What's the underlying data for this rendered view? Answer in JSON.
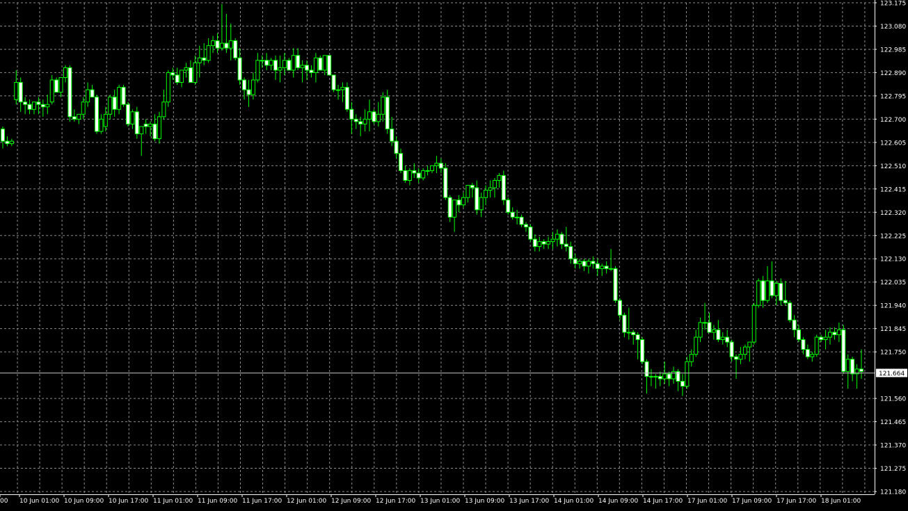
{
  "chart_data": {
    "type": "candlestick",
    "timeframe": "H1",
    "ylim": [
      121.18,
      123.175
    ],
    "y_ticks": [
      "123.175",
      "123.080",
      "122.985",
      "122.890",
      "122.795",
      "122.700",
      "122.605",
      "122.510",
      "122.415",
      "122.320",
      "122.225",
      "122.130",
      "122.035",
      "121.940",
      "121.845",
      "121.750",
      "121.664",
      "121.560",
      "121.465",
      "121.370",
      "121.275",
      "121.180"
    ],
    "x_ticks": [
      "00",
      "10 Jun 01:00",
      "10 Jun 09:00",
      "10 Jun 17:00",
      "11 Jun 01:00",
      "11 Jun 09:00",
      "11 Jun 17:00",
      "12 Jun 01:00",
      "12 Jun 09:00",
      "12 Jun 17:00",
      "13 Jun 01:00",
      "13 Jun 09:00",
      "13 Jun 17:00",
      "14 Jun 01:00",
      "14 Jun 09:00",
      "14 Jun 17:00",
      "17 Jun 01:00",
      "17 Jun 09:00",
      "17 Jun 17:00",
      "18 Jun 01:00"
    ],
    "current_price": "121.664",
    "grid": true,
    "colors": {
      "background": "#000000",
      "grid": "#8c8c8c",
      "axis_text": "#ffffff",
      "bull_body": "#000000",
      "bear_body": "#ffffff",
      "wick": "#00ff00",
      "price_line": "#c0c0c0"
    },
    "candles": [
      [
        122.66,
        122.67,
        122.58,
        122.61
      ],
      [
        122.61,
        122.63,
        122.59,
        122.6
      ],
      [
        122.6,
        122.62,
        122.59,
        122.61
      ],
      [
        122.78,
        122.9,
        122.76,
        122.85
      ],
      [
        122.85,
        122.87,
        122.73,
        122.77
      ],
      [
        122.77,
        122.79,
        122.72,
        122.76
      ],
      [
        122.76,
        122.78,
        122.72,
        122.74
      ],
      [
        122.74,
        122.77,
        122.72,
        122.77
      ],
      [
        122.77,
        122.79,
        122.72,
        122.76
      ],
      [
        122.76,
        122.78,
        122.71,
        122.75
      ],
      [
        122.75,
        122.8,
        122.72,
        122.76
      ],
      [
        122.77,
        122.88,
        122.76,
        122.86
      ],
      [
        122.86,
        122.87,
        122.81,
        122.81
      ],
      [
        122.81,
        122.87,
        122.79,
        122.87
      ],
      [
        122.87,
        122.92,
        122.85,
        122.91
      ],
      [
        122.91,
        122.92,
        122.69,
        122.71
      ],
      [
        122.71,
        122.74,
        122.69,
        122.7
      ],
      [
        122.7,
        122.72,
        122.68,
        122.72
      ],
      [
        122.72,
        122.79,
        122.7,
        122.77
      ],
      [
        122.77,
        122.85,
        122.75,
        122.82
      ],
      [
        122.82,
        122.84,
        122.79,
        122.79
      ],
      [
        122.79,
        122.8,
        122.64,
        122.65
      ],
      [
        122.65,
        122.72,
        122.64,
        122.7
      ],
      [
        122.67,
        122.75,
        122.65,
        122.72
      ],
      [
        122.72,
        122.8,
        122.7,
        122.79
      ],
      [
        122.79,
        122.82,
        122.71,
        122.74
      ],
      [
        122.74,
        122.84,
        122.72,
        122.83
      ],
      [
        122.83,
        122.84,
        122.75,
        122.76
      ],
      [
        122.76,
        122.77,
        122.67,
        122.68
      ],
      [
        122.68,
        122.74,
        122.66,
        122.73
      ],
      [
        122.73,
        122.75,
        122.62,
        122.64
      ],
      [
        122.64,
        122.65,
        122.55,
        122.67
      ],
      [
        122.68,
        122.7,
        122.64,
        122.67
      ],
      [
        122.67,
        122.69,
        122.63,
        122.68
      ],
      [
        122.68,
        122.72,
        122.61,
        122.62
      ],
      [
        122.62,
        122.73,
        122.6,
        122.71
      ],
      [
        122.71,
        122.82,
        122.7,
        122.77
      ],
      [
        122.77,
        122.9,
        122.75,
        122.89
      ],
      [
        122.89,
        122.91,
        122.86,
        122.88
      ],
      [
        122.88,
        122.91,
        122.84,
        122.85
      ],
      [
        122.85,
        122.9,
        122.83,
        122.9
      ],
      [
        122.9,
        122.93,
        122.87,
        122.91
      ],
      [
        122.91,
        122.94,
        122.86,
        122.85
      ],
      [
        122.85,
        122.96,
        122.84,
        122.93
      ],
      [
        122.93,
        123.0,
        122.87,
        122.95
      ],
      [
        122.95,
        123.01,
        122.92,
        122.94
      ],
      [
        122.94,
        123.03,
        122.93,
        123.0
      ],
      [
        123.0,
        123.04,
        122.97,
        123.02
      ],
      [
        123.02,
        123.05,
        122.97,
        122.99
      ],
      [
        122.99,
        123.17,
        122.98,
        123.01
      ],
      [
        123.01,
        123.13,
        122.97,
        122.99
      ],
      [
        122.99,
        123.09,
        122.94,
        123.02
      ],
      [
        123.02,
        123.03,
        122.94,
        122.95
      ],
      [
        122.95,
        122.99,
        122.84,
        122.86
      ],
      [
        122.86,
        122.87,
        122.78,
        122.82
      ],
      [
        122.82,
        122.86,
        122.75,
        122.8
      ],
      [
        122.8,
        122.89,
        122.78,
        122.86
      ],
      [
        122.86,
        122.97,
        122.85,
        122.94
      ],
      [
        122.94,
        122.96,
        122.91,
        122.94
      ],
      [
        122.94,
        122.97,
        122.9,
        122.92
      ],
      [
        122.92,
        122.95,
        122.9,
        122.94
      ],
      [
        122.94,
        122.96,
        122.86,
        122.9
      ],
      [
        122.9,
        122.96,
        122.85,
        122.91
      ],
      [
        122.91,
        122.97,
        122.88,
        122.94
      ],
      [
        122.94,
        122.95,
        122.9,
        122.9
      ],
      [
        122.9,
        122.99,
        122.87,
        122.96
      ],
      [
        122.96,
        122.99,
        122.9,
        122.91
      ],
      [
        122.91,
        122.94,
        122.85,
        122.92
      ],
      [
        122.92,
        122.94,
        122.86,
        122.9
      ],
      [
        122.9,
        122.92,
        122.87,
        122.89
      ],
      [
        122.89,
        122.97,
        122.85,
        122.95
      ],
      [
        122.95,
        122.96,
        122.9,
        122.9
      ],
      [
        122.9,
        122.96,
        122.88,
        122.96
      ],
      [
        122.96,
        122.96,
        122.88,
        122.88
      ],
      [
        122.88,
        122.88,
        122.81,
        122.82
      ],
      [
        122.82,
        122.84,
        122.78,
        122.82
      ],
      [
        122.82,
        122.85,
        122.77,
        122.83
      ],
      [
        122.83,
        122.85,
        122.73,
        122.74
      ],
      [
        122.74,
        122.77,
        122.64,
        122.7
      ],
      [
        122.7,
        122.72,
        122.66,
        122.69
      ],
      [
        122.69,
        122.71,
        122.63,
        122.68
      ],
      [
        122.68,
        122.74,
        122.65,
        122.7
      ],
      [
        122.7,
        122.78,
        122.65,
        122.73
      ],
      [
        122.73,
        122.74,
        122.68,
        122.69
      ],
      [
        122.69,
        122.77,
        122.67,
        122.72
      ],
      [
        122.72,
        122.81,
        122.69,
        122.79
      ],
      [
        122.79,
        122.82,
        122.64,
        122.66
      ],
      [
        122.66,
        122.71,
        122.59,
        122.61
      ],
      [
        122.61,
        122.63,
        122.54,
        122.56
      ],
      [
        122.56,
        122.58,
        122.48,
        122.49
      ],
      [
        122.49,
        122.51,
        122.44,
        122.45
      ],
      [
        122.45,
        122.5,
        122.43,
        122.49
      ],
      [
        122.49,
        122.52,
        122.46,
        122.48
      ],
      [
        122.48,
        122.5,
        122.44,
        122.46
      ],
      [
        122.46,
        122.5,
        122.45,
        122.49
      ],
      [
        122.49,
        122.51,
        122.47,
        122.49
      ],
      [
        122.49,
        122.51,
        122.48,
        122.51
      ],
      [
        122.51,
        122.55,
        122.48,
        122.52
      ],
      [
        122.52,
        122.54,
        122.48,
        122.5
      ],
      [
        122.5,
        122.52,
        122.37,
        122.38
      ],
      [
        122.38,
        122.39,
        122.28,
        122.3
      ],
      [
        122.3,
        122.37,
        122.24,
        122.37
      ],
      [
        122.37,
        122.39,
        122.32,
        122.35
      ],
      [
        122.35,
        122.4,
        122.34,
        122.38
      ],
      [
        122.38,
        122.43,
        122.36,
        122.43
      ],
      [
        122.43,
        122.44,
        122.38,
        122.42
      ],
      [
        122.42,
        122.45,
        122.31,
        122.33
      ],
      [
        122.33,
        122.4,
        122.3,
        122.38
      ],
      [
        122.38,
        122.43,
        122.35,
        122.41
      ],
      [
        122.41,
        122.45,
        122.38,
        122.42
      ],
      [
        122.42,
        122.46,
        122.38,
        122.45
      ],
      [
        122.45,
        122.48,
        122.42,
        122.47
      ],
      [
        122.47,
        122.49,
        122.35,
        122.37
      ],
      [
        122.37,
        122.38,
        122.31,
        122.32
      ],
      [
        122.32,
        122.34,
        122.29,
        122.3
      ],
      [
        122.3,
        122.33,
        122.27,
        122.3
      ],
      [
        122.3,
        122.31,
        122.26,
        122.27
      ],
      [
        122.27,
        122.28,
        122.24,
        122.26
      ],
      [
        122.26,
        122.27,
        122.2,
        122.21
      ],
      [
        122.21,
        122.23,
        122.16,
        122.18
      ],
      [
        122.18,
        122.22,
        122.16,
        122.2
      ],
      [
        122.2,
        122.21,
        122.17,
        122.19
      ],
      [
        122.19,
        122.22,
        122.17,
        122.2
      ],
      [
        122.2,
        122.24,
        122.17,
        122.21
      ],
      [
        122.21,
        122.25,
        122.18,
        122.23
      ],
      [
        122.23,
        122.24,
        122.17,
        122.19
      ],
      [
        122.19,
        122.26,
        122.16,
        122.18
      ],
      [
        122.18,
        122.2,
        122.11,
        122.13
      ],
      [
        122.13,
        122.15,
        122.09,
        122.11
      ],
      [
        122.11,
        122.13,
        122.09,
        122.12
      ],
      [
        122.12,
        122.13,
        122.08,
        122.1
      ],
      [
        122.1,
        122.13,
        122.07,
        122.12
      ],
      [
        122.12,
        122.14,
        122.09,
        122.11
      ],
      [
        122.11,
        122.13,
        122.06,
        122.09
      ],
      [
        122.09,
        122.11,
        122.06,
        122.1
      ],
      [
        122.1,
        122.12,
        122.07,
        122.09
      ],
      [
        122.09,
        122.17,
        122.08,
        122.09
      ],
      [
        122.09,
        122.1,
        121.95,
        121.96
      ],
      [
        121.96,
        121.97,
        121.88,
        121.9
      ],
      [
        121.9,
        121.91,
        121.81,
        121.83
      ],
      [
        121.83,
        121.93,
        121.8,
        121.83
      ],
      [
        121.83,
        121.84,
        121.78,
        121.82
      ],
      [
        121.82,
        121.83,
        121.72,
        121.8
      ],
      [
        121.8,
        121.81,
        121.7,
        121.71
      ],
      [
        121.71,
        121.72,
        121.58,
        121.65
      ],
      [
        121.65,
        121.68,
        121.61,
        121.65
      ],
      [
        121.65,
        121.66,
        121.6,
        121.65
      ],
      [
        121.65,
        121.67,
        121.61,
        121.64
      ],
      [
        121.64,
        121.71,
        121.62,
        121.66
      ],
      [
        121.66,
        121.67,
        121.61,
        121.64
      ],
      [
        121.64,
        121.69,
        121.62,
        121.67
      ],
      [
        121.67,
        121.68,
        121.59,
        121.63
      ],
      [
        121.63,
        121.66,
        121.57,
        121.61
      ],
      [
        121.61,
        121.73,
        121.6,
        121.71
      ],
      [
        121.71,
        121.76,
        121.69,
        121.74
      ],
      [
        121.74,
        121.84,
        121.73,
        121.81
      ],
      [
        121.81,
        121.89,
        121.79,
        121.87
      ],
      [
        121.87,
        121.95,
        121.84,
        121.87
      ],
      [
        121.87,
        121.91,
        121.83,
        121.83
      ],
      [
        121.83,
        121.86,
        121.8,
        121.84
      ],
      [
        121.84,
        121.88,
        121.79,
        121.8
      ],
      [
        121.8,
        121.83,
        121.78,
        121.81
      ],
      [
        121.81,
        121.84,
        121.77,
        121.79
      ],
      [
        121.79,
        121.8,
        121.71,
        121.73
      ],
      [
        121.73,
        121.74,
        121.64,
        121.72
      ],
      [
        121.72,
        121.77,
        121.7,
        121.74
      ],
      [
        121.74,
        121.78,
        121.72,
        121.77
      ],
      [
        121.77,
        121.79,
        121.71,
        121.79
      ],
      [
        121.79,
        121.95,
        121.78,
        121.94
      ],
      [
        121.94,
        122.05,
        121.93,
        122.04
      ],
      [
        122.04,
        122.06,
        121.93,
        121.96
      ],
      [
        121.96,
        122.1,
        121.95,
        122.04
      ],
      [
        122.04,
        122.12,
        121.97,
        121.98
      ],
      [
        121.98,
        122.04,
        121.94,
        122.03
      ],
      [
        122.03,
        122.05,
        121.94,
        121.96
      ],
      [
        121.96,
        122.04,
        121.94,
        121.95
      ],
      [
        121.95,
        121.96,
        121.87,
        121.88
      ],
      [
        121.88,
        121.9,
        121.81,
        121.84
      ],
      [
        121.84,
        121.86,
        121.79,
        121.8
      ],
      [
        121.8,
        121.81,
        121.74,
        121.76
      ],
      [
        121.76,
        121.78,
        121.72,
        121.73
      ],
      [
        121.73,
        121.75,
        121.71,
        121.74
      ],
      [
        121.74,
        121.82,
        121.73,
        121.81
      ],
      [
        121.81,
        121.82,
        121.79,
        121.8
      ],
      [
        121.8,
        121.84,
        121.76,
        121.81
      ],
      [
        121.81,
        121.85,
        121.78,
        121.83
      ],
      [
        121.83,
        121.85,
        121.8,
        121.82
      ],
      [
        121.82,
        121.87,
        121.79,
        121.84
      ],
      [
        121.84,
        121.86,
        121.66,
        121.67
      ],
      [
        121.67,
        121.74,
        121.6,
        121.72
      ],
      [
        121.72,
        121.73,
        121.63,
        121.66
      ],
      [
        121.66,
        121.7,
        121.6,
        121.68
      ],
      [
        121.68,
        121.76,
        121.64,
        121.67
      ]
    ]
  }
}
